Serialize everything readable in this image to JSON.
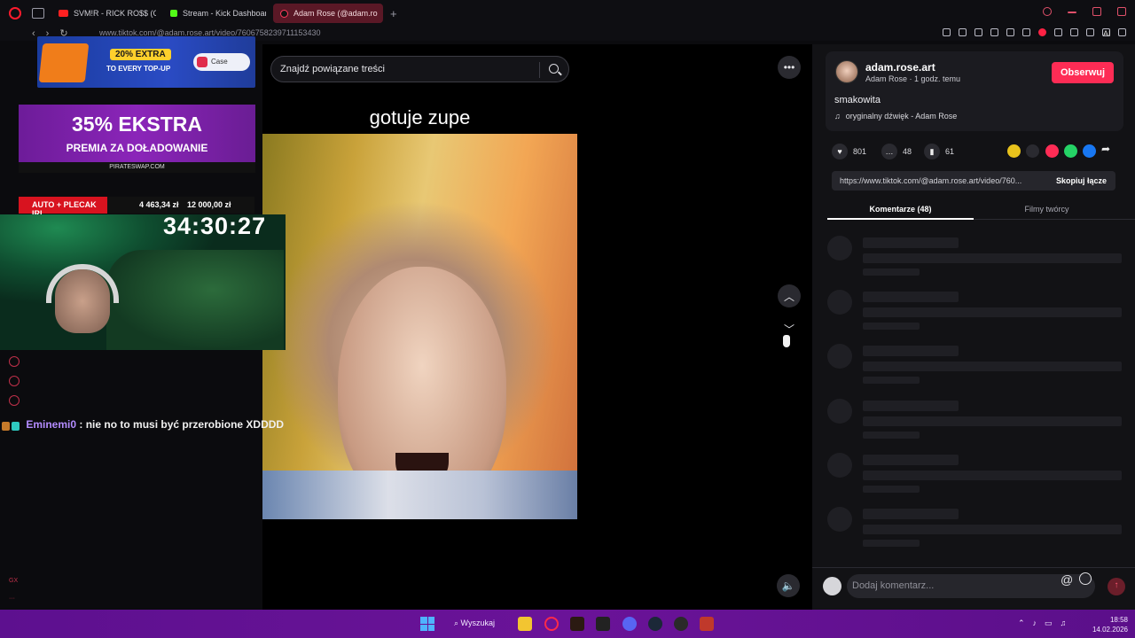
{
  "browser": {
    "tabs": [
      {
        "label": "SVM!R - RICK RO$$ (Offic",
        "favicon": "youtube-icon"
      },
      {
        "label": "Stream - Kick Dashboard",
        "favicon": "kick-icon"
      },
      {
        "label": "Adam Rose (@adam.ro",
        "favicon": "tiktok-icon",
        "active": true
      }
    ],
    "url": "www.tiktok.com/@adam.rose.art/video/7606758239711153430",
    "toolbar_ai": "AI"
  },
  "overlay": {
    "ad_top": {
      "pill": "20% EXTRA",
      "sub": "TO EVERY TOP-UP",
      "brand": "Case"
    },
    "ad_mid": {
      "big": "35% EKSTRA",
      "mid": "PREMIA ZA DOŁADOWANIE",
      "low": "PIRATESWAP.COM"
    },
    "goal": {
      "label": "AUTO + PLECAK IRL",
      "current": "4 463,34 zł",
      "target": "12 000,00 zł"
    },
    "timer": "34:30:27",
    "chat": {
      "user": "Eminemi0",
      "message": ": nie no to musi być przerobione XDDDD"
    }
  },
  "tiktok": {
    "search_placeholder": "Znajdź powiązane treści",
    "video_caption": "gotuje zupe",
    "author": {
      "username": "adam.rose.art",
      "meta": "Adam Rose · 1 godz. temu"
    },
    "follow_label": "Obserwuj",
    "description": "smakowita",
    "sound": "oryginalny dźwięk - Adam Rose",
    "likes": "801",
    "comments": "48",
    "saves": "61",
    "link_url": "https://www.tiktok.com/@adam.rose.art/video/760...",
    "copy_link": "Skopiuj łącze",
    "tab_comments": "Komentarze (48)",
    "tab_creator": "Filmy twórcy",
    "comment_placeholder": "Dodaj komentarz..."
  },
  "taskbar": {
    "search": "Wyszukaj",
    "time": "18:58",
    "date": "14.02.2026"
  },
  "colors": {
    "tiktok_red": "#fe2c55",
    "taskbar": "#6a1398",
    "goal_red": "#d8131f",
    "chat_user": "#b48cff"
  }
}
